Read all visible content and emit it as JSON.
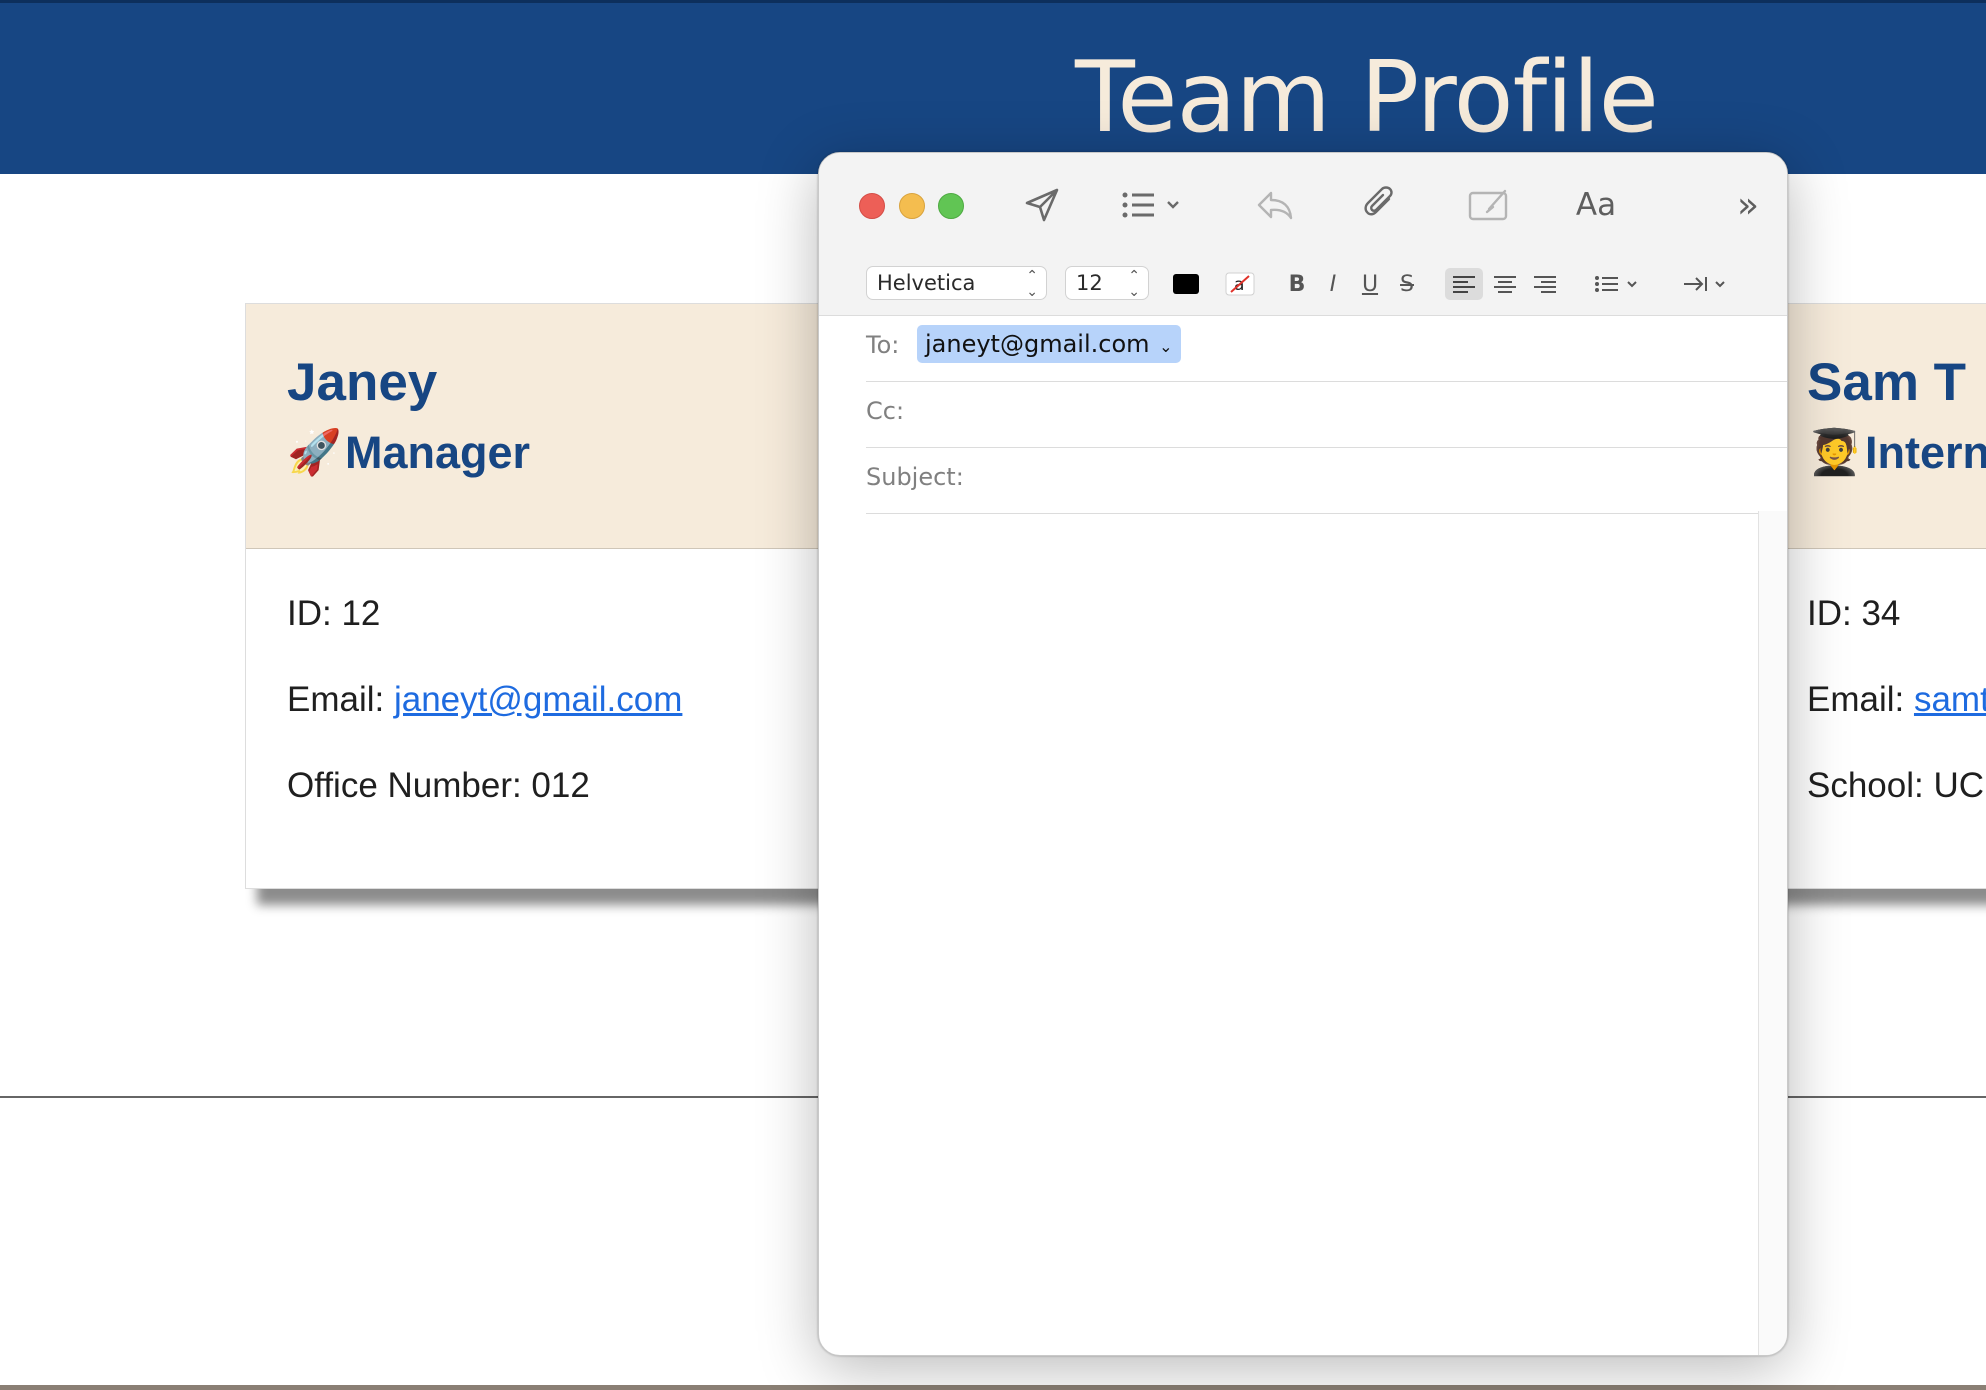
{
  "page": {
    "title": "Team Profile",
    "cards": [
      {
        "name": "Janey",
        "role_icon": "🚀",
        "role": "Manager",
        "id_line": "ID: 12",
        "email_label": "Email: ",
        "email": "janeyt@gmail.com",
        "extra_line": "Office Number: 012"
      },
      {
        "name": "Sam T",
        "role_icon": "🧑‍🎓",
        "role": "Intern",
        "id_line": "ID: 34",
        "email_label": "Email: ",
        "email": "samt",
        "extra_line": "School: UC"
      }
    ]
  },
  "compose": {
    "toolbar": {
      "icons": [
        "send-icon",
        "header-fields-icon",
        "reply-icon",
        "attachment-icon",
        "markup-icon",
        "format-text-icon",
        "more-icon"
      ],
      "format_label": "Aa",
      "more_label": "»"
    },
    "format_bar": {
      "font": "Helvetica",
      "size": "12",
      "text_color": "#000000",
      "bold": "B",
      "italic": "I",
      "underline": "U",
      "strike": "S"
    },
    "fields": {
      "to_label": "To:",
      "to_value": "janeyt@gmail.com",
      "cc_label": "Cc:",
      "subject_label": "Subject:"
    },
    "body": ""
  },
  "colors": {
    "header_bg": "#174683",
    "header_text": "#f6ebdb",
    "card_head_bg": "#f6ebdb",
    "link": "#1e6be0",
    "recipient_token": "#b7d3fa"
  }
}
